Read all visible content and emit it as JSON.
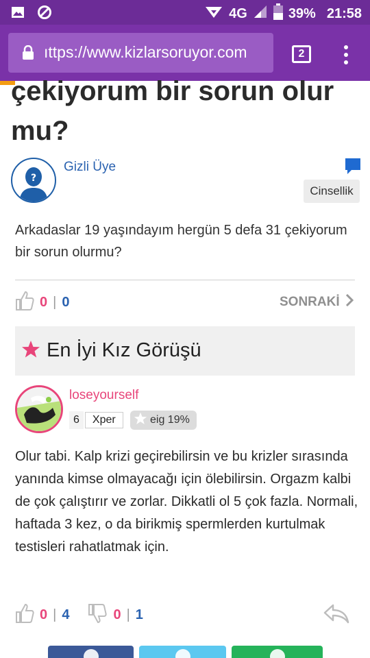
{
  "status_bar": {
    "network": "4G",
    "battery": "39%",
    "time": "21:58",
    "icons": [
      "gallery-icon",
      "blocked-icon",
      "wifi-icon",
      "signal-icon",
      "battery-icon"
    ]
  },
  "browser": {
    "url": "ıttps://www.kizlarsoruyor.com",
    "tab_count": "2",
    "icons": [
      "lock-icon",
      "menu-dots-icon"
    ]
  },
  "question": {
    "title": "çekiyorum bir sorun olur mu?",
    "author": "Gizli Üye",
    "category": "Cinsellik",
    "body": "Arkadaslar 19 yaşındayım hergün 5 defa 31 çekiyorum bir sorun olurmu?",
    "likes": "0",
    "separator": "|",
    "comments": "0",
    "next_label": "SONRAKİ"
  },
  "best_answer": {
    "section_title": "En İyi Kız Görüşü",
    "author": "loseyourself",
    "level": "6",
    "rank": "Xper",
    "eig": "eig 19%",
    "body": "Olur tabi. Kalp krizi geçirebilirsin ve bu krizler sırasında yanında kimse olmayacağı için ölebilirsin. Orgazm kalbi de çok çalıştırır ve zorlar. Dikkatli ol 5 çok fazla. Normali, haftada 3 kez, o da birikmiş spermlerden kurtulmak testisleri rahatlatmak için.",
    "likes": "0",
    "likes_total": "4",
    "dislikes": "0",
    "dislikes_total": "1"
  },
  "colors": {
    "status_bar": "#6c2c97",
    "url_bar": "#7a32a8",
    "pink": "#e8457a",
    "blue": "#2a62b0",
    "facebook": "#3b5998",
    "twitter": "#5bc8f0",
    "whatsapp": "#25b35a"
  },
  "share_buttons": [
    "facebook-button",
    "twitter-button",
    "whatsapp-button"
  ]
}
